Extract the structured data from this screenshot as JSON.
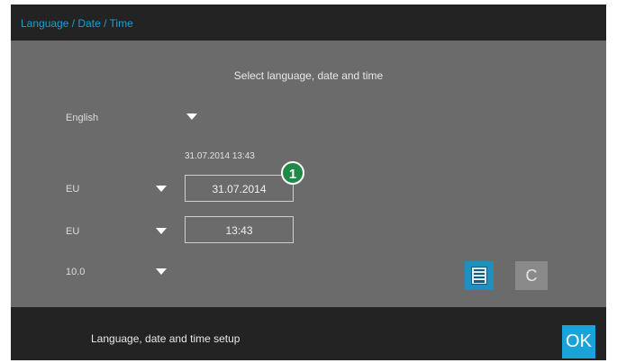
{
  "window": {
    "title": "Language / Date / Time"
  },
  "main": {
    "heading": "Select language, date and time",
    "language": {
      "value": "English"
    },
    "current_datetime": "31.07.2014 13:43",
    "date_format": {
      "value": "EU"
    },
    "date_field": {
      "value": "31.07.2014"
    },
    "time_format": {
      "value": "EU"
    },
    "time_field": {
      "value": "13:43"
    },
    "number_format": {
      "value": "10.0"
    },
    "callout": "1",
    "buttons": {
      "save_icon": "save-icon",
      "cancel_label": "C"
    }
  },
  "footer": {
    "text": "Language, date and time setup",
    "ok_label": "OK"
  },
  "colors": {
    "accent": "#1a9fd0",
    "background": "#6b6b6b",
    "bar": "#232323",
    "callout": "#1f8a46"
  }
}
